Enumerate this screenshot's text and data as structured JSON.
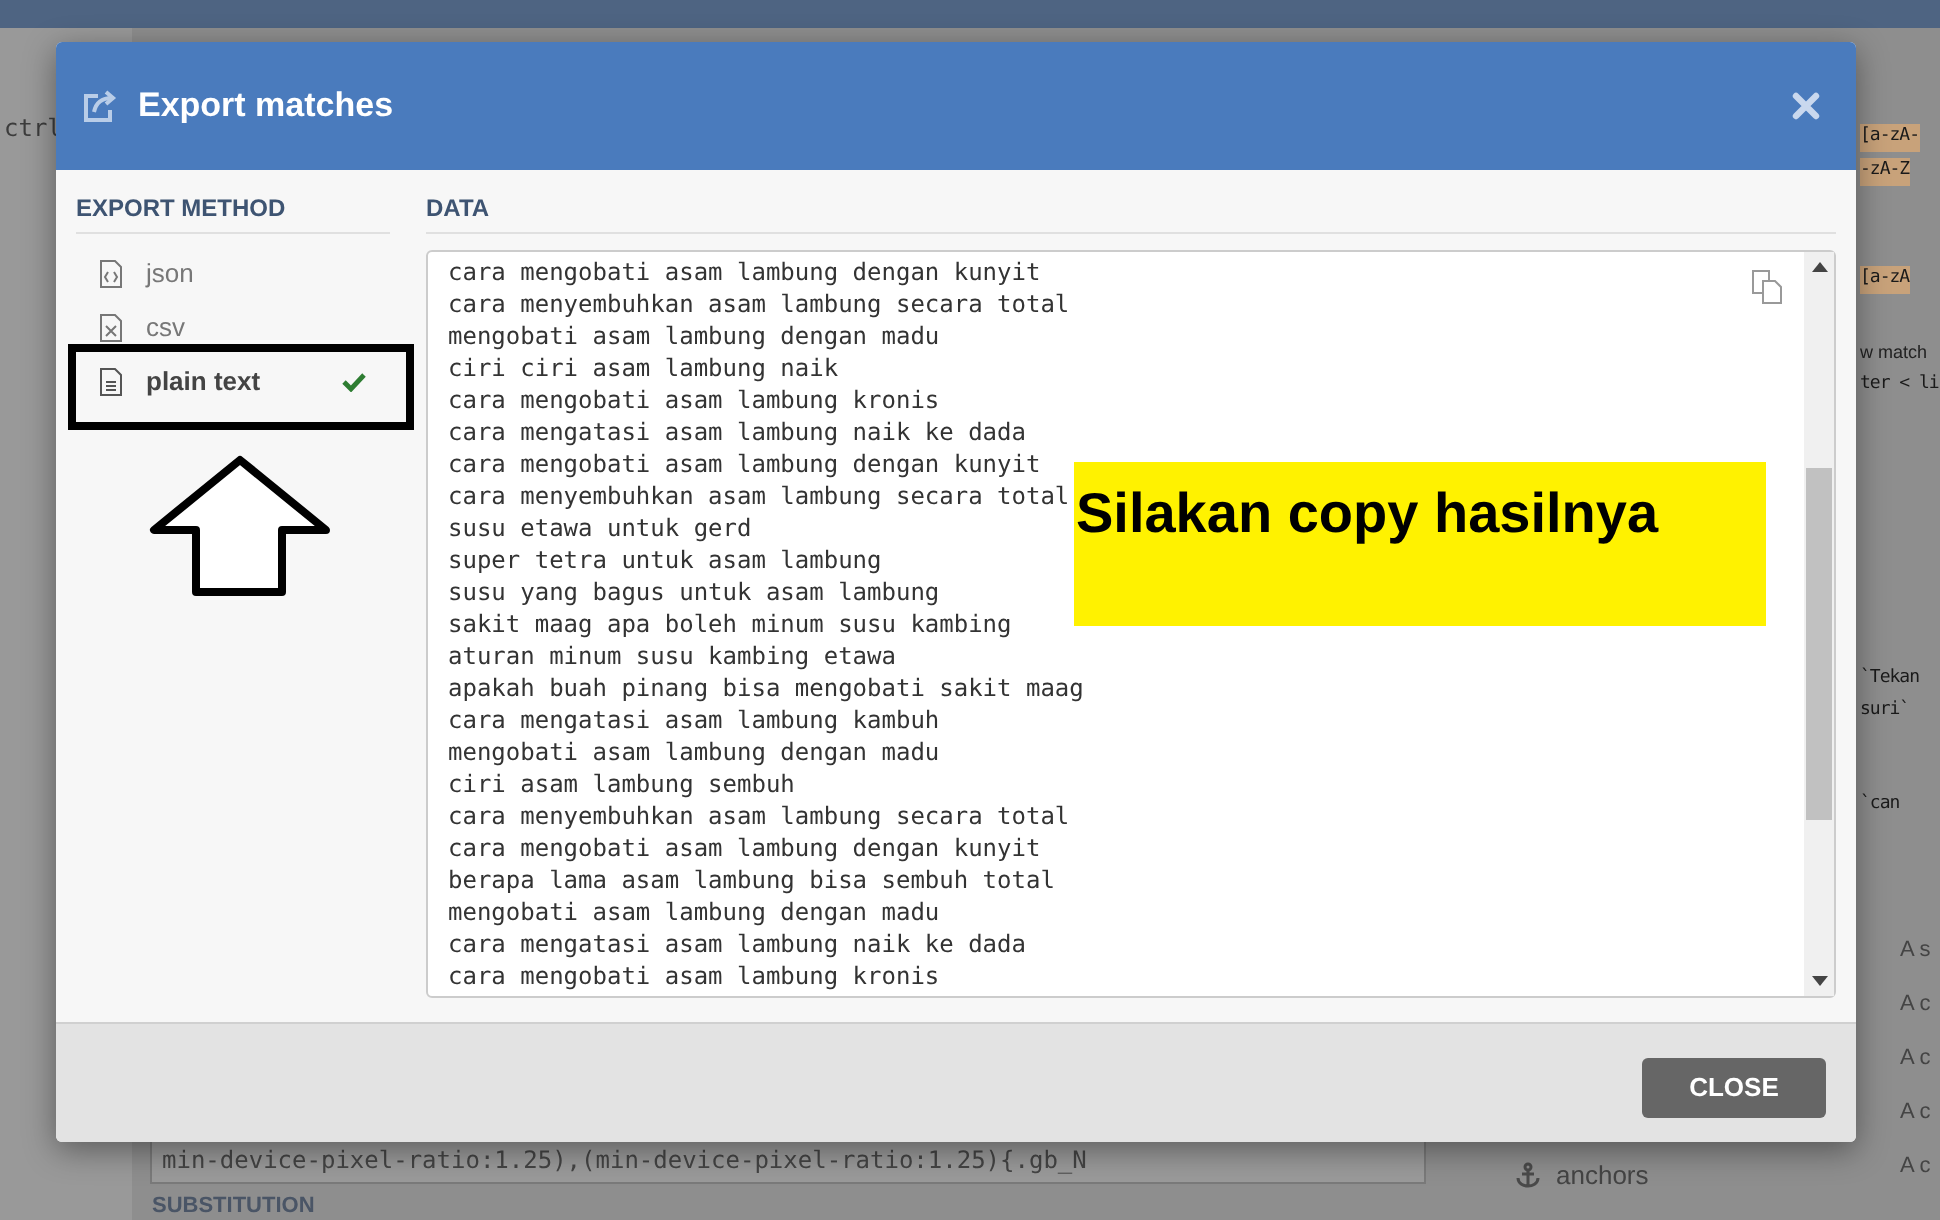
{
  "background": {
    "editor_fragment": "ctrl",
    "side_fragments": [
      {
        "kind": "code-highlight",
        "text": "[a-zA-"
      },
      {
        "kind": "code-highlight",
        "text": "-zA-Z"
      },
      {
        "kind": "code-highlight",
        "text": "[a-zA"
      },
      {
        "kind": "label",
        "text": "w match"
      },
      {
        "kind": "code",
        "text": "ter < li"
      },
      {
        "kind": "code",
        "text": "`Tekan"
      },
      {
        "kind": "code",
        "text": "suri`"
      },
      {
        "kind": "code",
        "text": "`can"
      },
      {
        "kind": "list",
        "text": "A s"
      },
      {
        "kind": "list",
        "text": "A c"
      },
      {
        "kind": "list",
        "text": "A c"
      },
      {
        "kind": "list",
        "text": "A c"
      },
      {
        "kind": "list",
        "text": "A c"
      }
    ],
    "pattern_value": "min-device-pixel-ratio:1.25),(min-device-pixel-ratio:1.25){.gb_N",
    "section_heading": "SUBSTITUTION",
    "sidebar_link": "anchors"
  },
  "dialog": {
    "title": "Export matches",
    "export_method": {
      "heading": "EXPORT METHOD",
      "options": [
        {
          "kind": "code",
          "label": "json",
          "selected": false
        },
        {
          "kind": "sheet",
          "label": "csv",
          "selected": false
        },
        {
          "kind": "text",
          "label": "plain text",
          "selected": true
        }
      ]
    },
    "data": {
      "heading": "DATA",
      "lines": [
        "cara mengobati asam lambung dengan kunyit",
        "cara menyembuhkan asam lambung secara total",
        "mengobati asam lambung dengan madu",
        "ciri ciri asam lambung naik",
        "cara mengobati asam lambung kronis",
        "cara mengatasi asam lambung naik ke dada",
        "cara mengobati asam lambung dengan kunyit",
        "cara menyembuhkan asam lambung secara total",
        "susu etawa untuk gerd",
        "super tetra untuk asam lambung",
        "susu yang bagus untuk asam lambung",
        "sakit maag apa boleh minum susu kambing",
        "aturan minum susu kambing etawa",
        "apakah buah pinang bisa mengobati sakit maag",
        "cara mengatasi asam lambung kambuh",
        "mengobati asam lambung dengan madu",
        "ciri asam lambung sembuh",
        "cara menyembuhkan asam lambung secara total",
        "cara mengobati asam lambung dengan kunyit",
        "berapa lama asam lambung bisa sembuh total",
        "mengobati asam lambung dengan madu",
        "cara mengatasi asam lambung naik ke dada",
        "cara mengobati asam lambung kronis"
      ]
    },
    "close_button": "CLOSE"
  },
  "annotation": {
    "callout": "Silakan copy hasilnya"
  }
}
